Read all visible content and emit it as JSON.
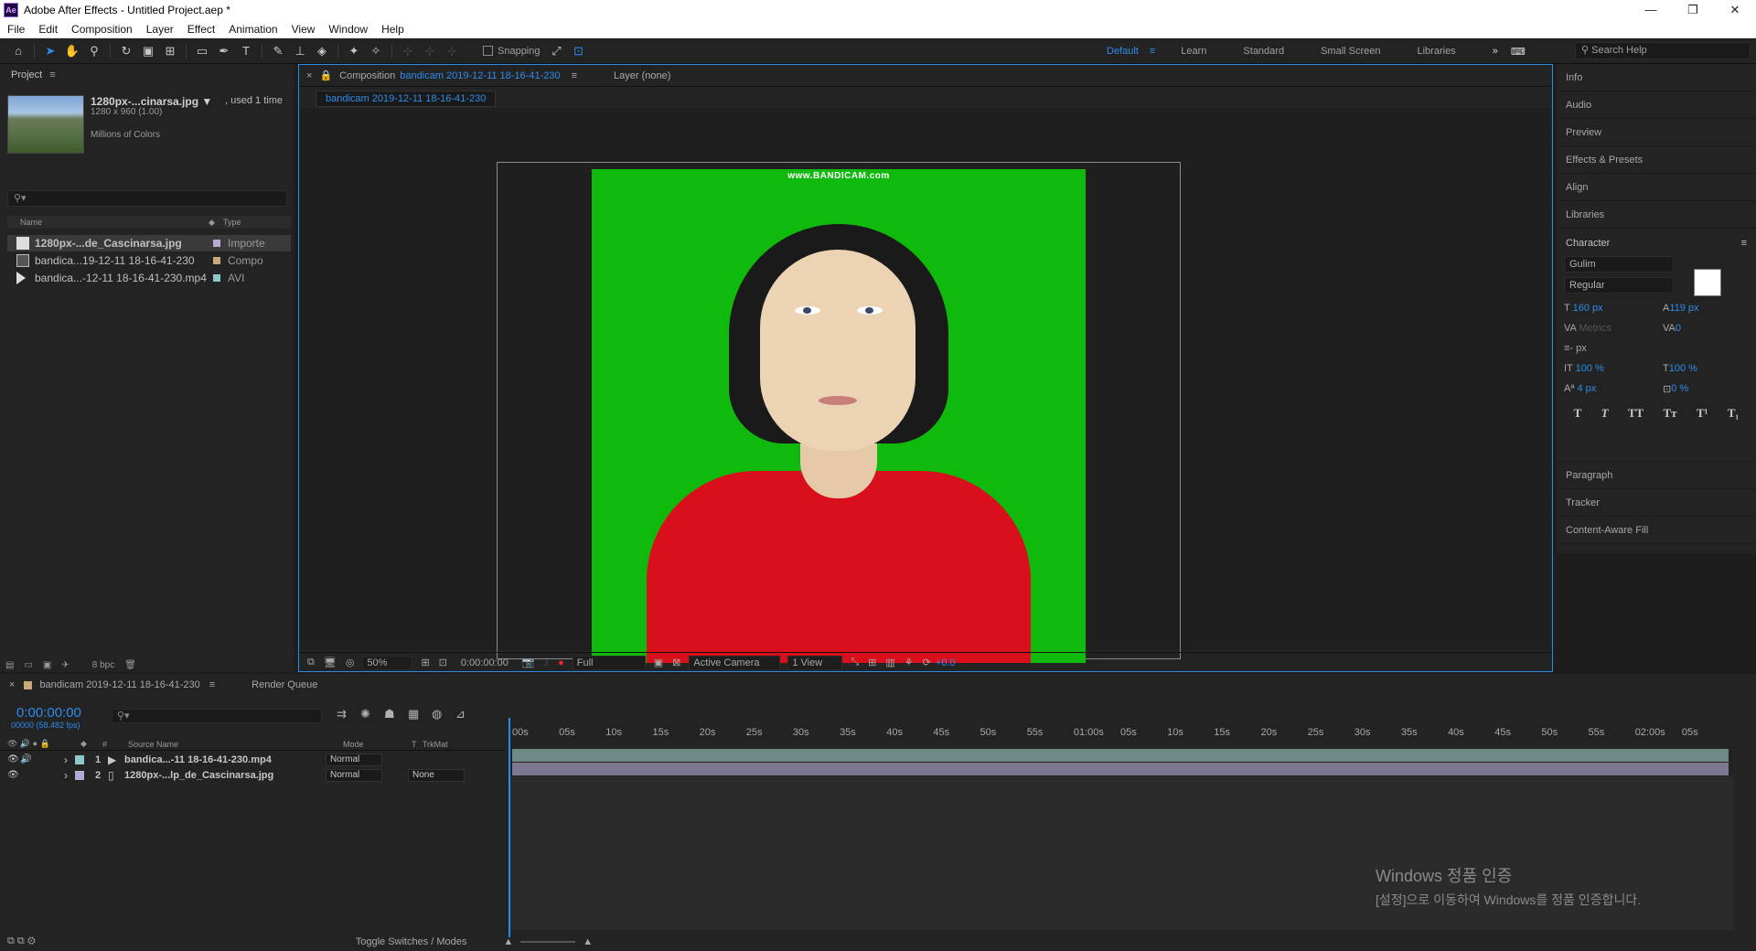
{
  "window": {
    "title": "Adobe After Effects - Untitled Project.aep *",
    "logo": "Ae",
    "min": "—",
    "max": "❐",
    "close": "✕"
  },
  "menu": [
    "File",
    "Edit",
    "Composition",
    "Layer",
    "Effect",
    "Animation",
    "View",
    "Window",
    "Help"
  ],
  "toolbar": {
    "snapping_label": "Snapping"
  },
  "workspaces": {
    "current": "Default",
    "items": [
      "Learn",
      "Standard",
      "Small Screen",
      "Libraries"
    ],
    "more": "»"
  },
  "search": {
    "placeholder": "Search Help"
  },
  "project": {
    "panel_title": "Project",
    "selected_name": "1280px-...cinarsa.jpg ▼",
    "used": ", used 1 time",
    "dimensions": "1280 x 960 (1.00)",
    "colors": "Millions of Colors",
    "columns": {
      "name": "Name",
      "type": "Type"
    },
    "items": [
      {
        "name": "1280px-...de_Cascinarsa.jpg",
        "type": "Importe",
        "swatch": "#b7a9d6"
      },
      {
        "name": "bandica...19-12-11 18-16-41-230",
        "type": "Compo",
        "swatch": "#c8a878"
      },
      {
        "name": "bandica...-12-11 18-16-41-230.mp4",
        "type": "AVI",
        "swatch": "#8fc8c8"
      }
    ],
    "bpc": "8 bpc"
  },
  "composition": {
    "tab_prefix": "Composition",
    "tab_name": "bandicam 2019-12-11 18-16-41-230",
    "layer_tab": "Layer (none)",
    "subtab": "bandicam 2019-12-11 18-16-41-230",
    "watermark": "www.BANDICAM.com",
    "footer": {
      "zoom": "50%",
      "time": "0:00:00:00",
      "resolution": "Full",
      "camera": "Active Camera",
      "views": "1 View",
      "exposure": "+0.0"
    }
  },
  "right_panels": [
    "Info",
    "Audio",
    "Preview",
    "Effects & Presets",
    "Align",
    "Libraries"
  ],
  "character": {
    "title": "Character",
    "font": "Gulim",
    "style": "Regular",
    "size": "160 px",
    "leading": "119 px",
    "kerning": "Metrics",
    "tracking": "0",
    "stroke": "- px",
    "vscale": "100 %",
    "hscale": "100 %",
    "baseline": "4 px",
    "tsume": "0 %",
    "styles": [
      "T",
      "T",
      "TT",
      "Tт",
      "T¹",
      "T₁"
    ]
  },
  "right_panels_bottom": [
    "Paragraph",
    "Tracker",
    "Content-Aware Fill"
  ],
  "timeline": {
    "tab": "bandicam 2019-12-11 18-16-41-230",
    "render_queue": "Render Queue",
    "timecode": "0:00:00:00",
    "fps": "00000 (58.482 fps)",
    "columns": {
      "source": "Source Name",
      "mode": "Mode",
      "t": "T",
      "trkmat": "TrkMat"
    },
    "layers": [
      {
        "num": "1",
        "name": "bandica...-11 18-16-41-230.mp4",
        "mode": "Normal",
        "trkmat": "",
        "color": "#8fc8c8"
      },
      {
        "num": "2",
        "name": "1280px-...lp_de_Cascinarsa.jpg",
        "mode": "Normal",
        "trkmat": "None",
        "color": "#b7a9d6"
      }
    ],
    "ruler": [
      "00s",
      "05s",
      "10s",
      "15s",
      "20s",
      "25s",
      "30s",
      "35s",
      "40s",
      "45s",
      "50s",
      "55s",
      "01:00s",
      "05s",
      "10s",
      "15s",
      "20s",
      "25s",
      "30s",
      "35s",
      "40s",
      "45s",
      "50s",
      "55s",
      "02:00s",
      "05s"
    ],
    "toggle": "Toggle Switches / Modes"
  },
  "activation": {
    "line1": "Windows 정품 인증",
    "line2": "[설정]으로 이동하여 Windows를 정품 인증합니다."
  },
  "colors": {
    "accent": "#2d8ceb",
    "green_screen": "#0fba0d",
    "coat": "#d9101c"
  }
}
